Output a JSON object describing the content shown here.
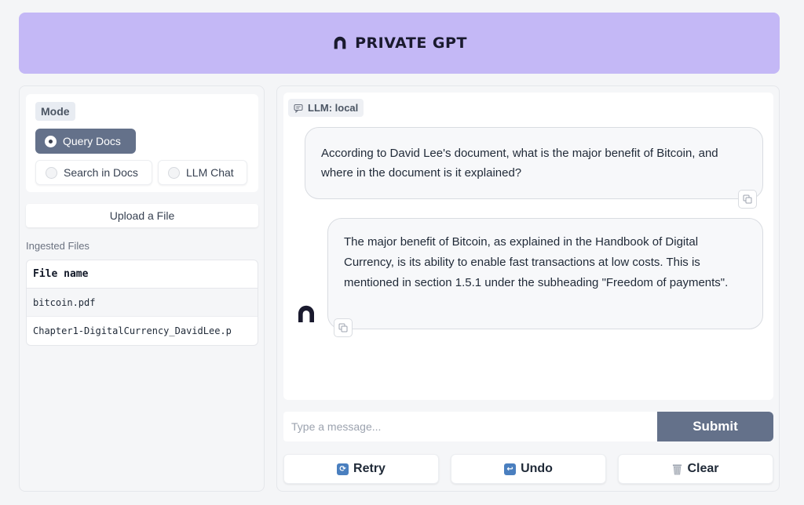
{
  "app": {
    "title": "PRIVATE GPT",
    "logo_icon": "privategpt-logo-icon"
  },
  "sidebar": {
    "mode_label": "Mode",
    "modes": [
      {
        "label": "Query Docs",
        "selected": true
      },
      {
        "label": "Search in Docs",
        "selected": false
      },
      {
        "label": "LLM Chat",
        "selected": false
      }
    ],
    "upload_label": "Upload a File",
    "ingested_label": "Ingested Files",
    "files_table": {
      "header": "File name",
      "rows": [
        "bitcoin.pdf",
        "Chapter1-DigitalCurrency_DavidLee.p"
      ]
    }
  },
  "chat": {
    "llm_badge": "LLM: local",
    "messages": [
      {
        "role": "user",
        "text": "According to David Lee's document, what is the major benefit of Bitcoin, and where in the document is it explained?"
      },
      {
        "role": "assistant",
        "text": "The major benefit of Bitcoin, as explained in the Handbook of Digital Currency, is its ability to enable fast transactions at low costs. This is mentioned in section 1.5.1 under the subheading \"Freedom of payments\"."
      }
    ],
    "input_placeholder": "Type a message...",
    "submit_label": "Submit",
    "actions": [
      {
        "label": "Retry",
        "icon": "retry-icon"
      },
      {
        "label": "Undo",
        "icon": "undo-icon"
      },
      {
        "label": "Clear",
        "icon": "trash-icon"
      }
    ]
  },
  "colors": {
    "header_bg": "#c4b8f6",
    "accent": "#64718a"
  }
}
